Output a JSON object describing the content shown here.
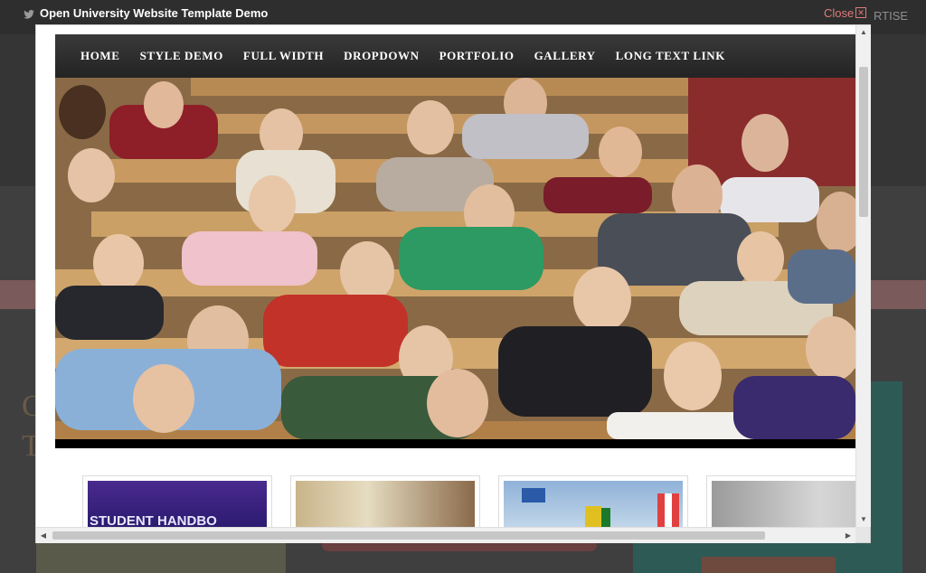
{
  "background_page": {
    "advertise_fragment": "RTISE",
    "left_heading_fragment": "C\nT"
  },
  "lightbox": {
    "title": "Open University Website Template Demo",
    "close_label": "Close",
    "close_icon": "close-icon",
    "title_icon": "twitter-bird-icon"
  },
  "nav": {
    "items": [
      "HOME",
      "STYLE DEMO",
      "FULL WIDTH",
      "DROPDOWN",
      "PORTFOLIO",
      "GALLERY",
      "LONG TEXT LINK"
    ]
  },
  "hero": {
    "description_icon": "lecture-hall-students-photo"
  },
  "thumbnails": {
    "items": [
      {
        "label": "STUDENT HANDBO"
      },
      {
        "label": ""
      },
      {
        "label": ""
      },
      {
        "label": ""
      }
    ]
  },
  "colors": {
    "nav_bg": "#2b2b2b",
    "close_text": "#e07a7a",
    "overlay_bg": "#3f3f3f"
  }
}
